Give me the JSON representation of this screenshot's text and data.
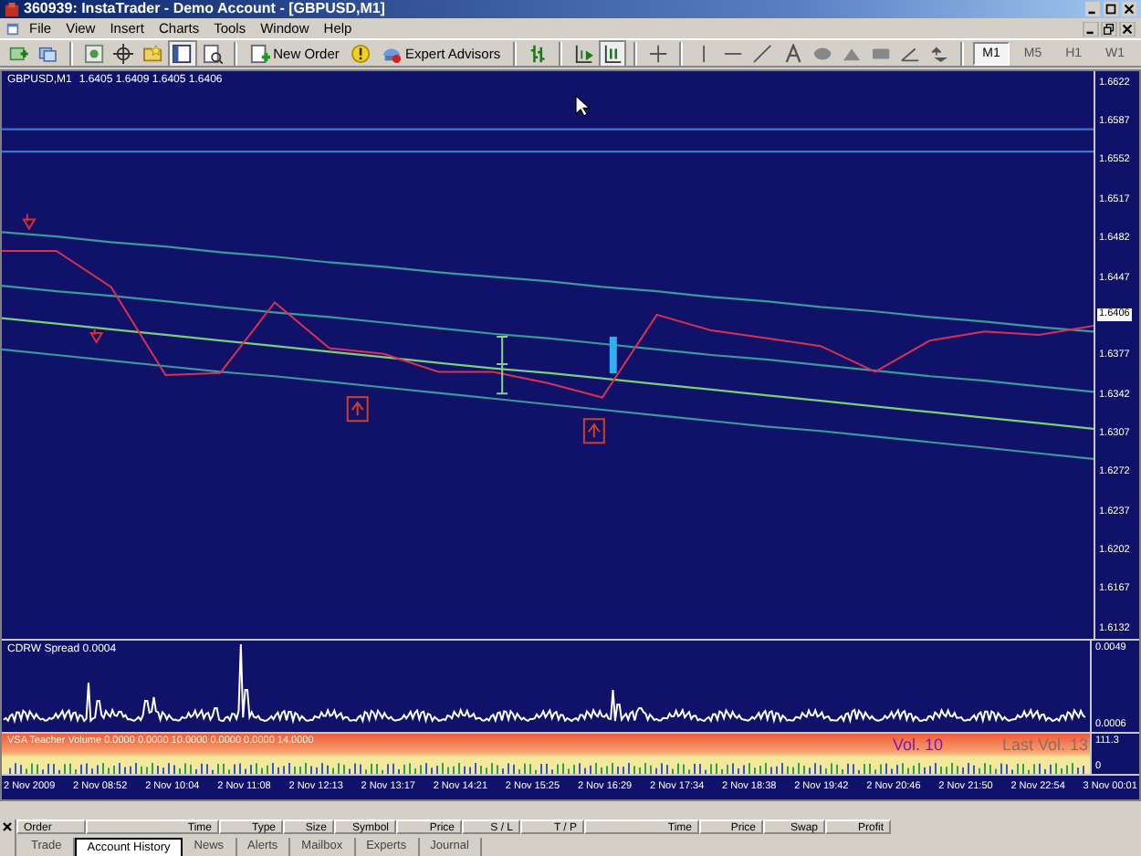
{
  "window": {
    "title": "360939: InstaTrader - Demo Account - [GBPUSD,M1]"
  },
  "menu": [
    "File",
    "View",
    "Insert",
    "Charts",
    "Tools",
    "Window",
    "Help"
  ],
  "toolbar": {
    "new_order": "New Order",
    "expert_advisors": "Expert Advisors",
    "timeframes": [
      {
        "label": "M1",
        "selected": true
      },
      {
        "label": "M5",
        "selected": false
      },
      {
        "label": "H1",
        "selected": false
      },
      {
        "label": "W1",
        "selected": false
      }
    ]
  },
  "chart": {
    "quote": "1.6405 1.6409 1.6405 1.6406",
    "chart_data": {
      "type": "line",
      "ylim": [
        1.6125,
        1.6633
      ],
      "yticks": [
        1.6622,
        1.6587,
        1.6552,
        1.6517,
        1.6482,
        1.6447,
        1.6377,
        1.6342,
        1.6307,
        1.6272,
        1.6237,
        1.6202,
        1.6167,
        1.6132
      ],
      "series": [
        {
          "name": "GBPUSD,M1",
          "color": "#d83050",
          "values": [
            1.6472,
            1.6472,
            1.644,
            1.6361,
            1.6363,
            1.6426,
            1.6385,
            1.638,
            1.6364,
            1.6364,
            1.6354,
            1.6341,
            1.6415,
            1.6401,
            1.6394,
            1.6387,
            1.6364,
            1.6392,
            1.64,
            1.6397,
            1.6405
          ]
        },
        {
          "color": "#3a78d0",
          "values": [
            1.6581,
            1.6581,
            1.6581,
            1.6581,
            1.6581,
            1.6581,
            1.6581,
            1.6581,
            1.6581,
            1.6581,
            1.6581,
            1.6581,
            1.6581,
            1.6581,
            1.6581,
            1.6581,
            1.6581,
            1.6581,
            1.6581,
            1.6581,
            1.6581
          ]
        },
        {
          "color": "#3a78d0",
          "values": [
            1.6561,
            1.6561,
            1.6561,
            1.6561,
            1.6561,
            1.6561,
            1.6561,
            1.6561,
            1.6561,
            1.6561,
            1.6561,
            1.6561,
            1.6561,
            1.6561,
            1.6561,
            1.6561,
            1.6561,
            1.6561,
            1.6561,
            1.6561,
            1.6561
          ]
        },
        {
          "color": "#3a9a9a",
          "values": [
            1.6489,
            1.6485,
            1.648,
            1.6476,
            1.6471,
            1.6467,
            1.6462,
            1.6458,
            1.6453,
            1.6449,
            1.6445,
            1.644,
            1.6436,
            1.6431,
            1.6427,
            1.6422,
            1.6418,
            1.6413,
            1.6409,
            1.6404,
            1.64
          ]
        },
        {
          "color": "#3a9a9a",
          "values": [
            1.6441,
            1.6436,
            1.6432,
            1.6427,
            1.6422,
            1.6417,
            1.6413,
            1.6408,
            1.6403,
            1.6398,
            1.6394,
            1.6389,
            1.6384,
            1.6379,
            1.6375,
            1.637,
            1.6365,
            1.636,
            1.6356,
            1.6351,
            1.6346
          ]
        },
        {
          "color": "#7ad07a",
          "values": [
            1.6412,
            1.6407,
            1.6402,
            1.6397,
            1.6392,
            1.6387,
            1.6382,
            1.6377,
            1.6372,
            1.6367,
            1.6363,
            1.6358,
            1.6353,
            1.6348,
            1.6343,
            1.6338,
            1.6333,
            1.6328,
            1.6323,
            1.6318,
            1.6313
          ]
        },
        {
          "color": "#3a9a9a",
          "values": [
            1.6384,
            1.6379,
            1.6374,
            1.6369,
            1.6364,
            1.636,
            1.6355,
            1.635,
            1.6345,
            1.634,
            1.6335,
            1.633,
            1.6325,
            1.632,
            1.6315,
            1.6311,
            1.6306,
            1.6301,
            1.6296,
            1.6291,
            1.6286
          ]
        }
      ]
    },
    "current_price": "1.6406"
  },
  "spread_indicator": {
    "label": "CDRW Spread 0.0004",
    "axis": [
      "0.0049",
      "0.0006"
    ]
  },
  "volume_indicator": {
    "label": "VSA Teacher Volume 0.0000 0.0000 10.0000 0.0000 0.0000 14.0000",
    "vol": "Vol. 10",
    "last_vol": "Last Vol. 13",
    "axis": [
      "111.3",
      "0"
    ]
  },
  "time_axis": [
    "2 Nov 2009",
    "2 Nov 08:52",
    "2 Nov 10:04",
    "2 Nov 11:08",
    "2 Nov 12:13",
    "2 Nov 13:17",
    "2 Nov 14:21",
    "2 Nov 15:25",
    "2 Nov 16:29",
    "2 Nov 17:34",
    "2 Nov 18:38",
    "2 Nov 19:42",
    "2 Nov 20:46",
    "2 Nov 21:50",
    "2 Nov 22:54",
    "3 Nov 00:01"
  ],
  "terminal": {
    "columns": [
      "Order",
      "Time",
      "Type",
      "Size",
      "Symbol",
      "Price",
      "S / L",
      "T / P",
      "Time",
      "Price",
      "Swap",
      "Profit"
    ],
    "tabs": [
      {
        "label": "Trade",
        "selected": false
      },
      {
        "label": "Account History",
        "selected": true
      },
      {
        "label": "News",
        "selected": false
      },
      {
        "label": "Alerts",
        "selected": false
      },
      {
        "label": "Mailbox",
        "selected": false
      },
      {
        "label": "Experts",
        "selected": false
      },
      {
        "label": "Journal",
        "selected": false
      }
    ]
  }
}
